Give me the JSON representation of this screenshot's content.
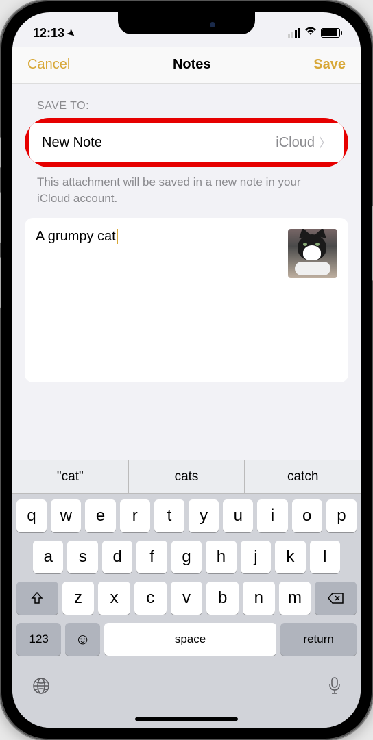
{
  "status": {
    "time": "12:13",
    "location_icon": "location-arrow"
  },
  "nav": {
    "cancel": "Cancel",
    "title": "Notes",
    "save": "Save"
  },
  "section": {
    "label": "SAVE TO:",
    "row_title": "New Note",
    "row_destination": "iCloud",
    "helper": "This attachment will be saved in a new note in your iCloud account."
  },
  "note": {
    "text": "A grumpy cat"
  },
  "keyboard": {
    "suggestions": [
      "\"cat\"",
      "cats",
      "catch"
    ],
    "row1": [
      "q",
      "w",
      "e",
      "r",
      "t",
      "y",
      "u",
      "i",
      "o",
      "p"
    ],
    "row2": [
      "a",
      "s",
      "d",
      "f",
      "g",
      "h",
      "j",
      "k",
      "l"
    ],
    "row3": [
      "z",
      "x",
      "c",
      "v",
      "b",
      "n",
      "m"
    ],
    "numeric": "123",
    "space": "space",
    "return": "return"
  }
}
